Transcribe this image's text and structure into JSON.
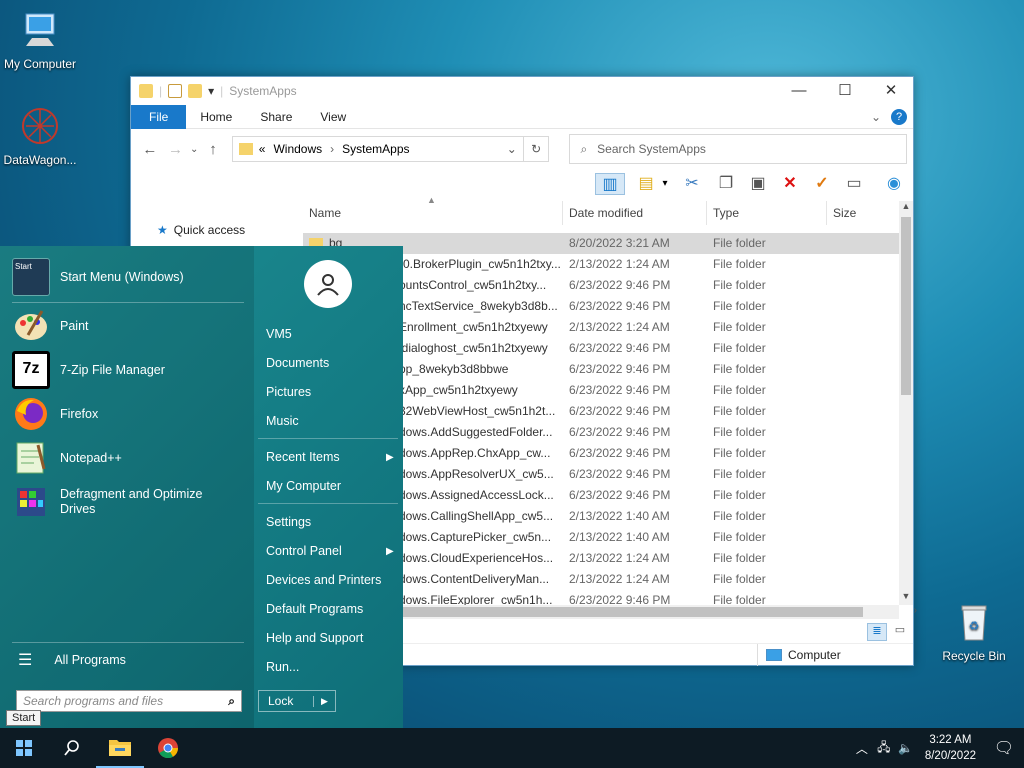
{
  "desktop": {
    "icons": [
      {
        "label": "My Computer",
        "icon": "monitor-icon"
      },
      {
        "label": "DataWagon...",
        "icon": "datawagon-icon"
      },
      {
        "label": "Recycle Bin",
        "icon": "recycle-bin-icon"
      }
    ]
  },
  "explorer": {
    "title": "SystemApps",
    "ribbon_tabs": [
      "File",
      "Home",
      "Share",
      "View"
    ],
    "address": {
      "prefix": "«",
      "crumbs": [
        "Windows",
        "SystemApps"
      ]
    },
    "search_placeholder": "Search SystemApps",
    "nav_quick_access": "Quick access",
    "columns": [
      "Name",
      "Date modified",
      "Type",
      "Size"
    ],
    "rows": [
      {
        "name": "bg",
        "date": "8/20/2022 3:21 AM",
        "type": "File folder",
        "selected": true
      },
      {
        "name": ")0.BrokerPlugin_cw5n1h2txy...",
        "date": "2/13/2022 1:24 AM",
        "type": "File folder"
      },
      {
        "name": "ountsControl_cw5n1h2txy...",
        "date": "6/23/2022 9:46 PM",
        "type": "File folder"
      },
      {
        "name": "ncTextService_8wekyb3d8b...",
        "date": "6/23/2022 9:46 PM",
        "type": "File folder"
      },
      {
        "name": "Enrollment_cw5n1h2txyewy",
        "date": "2/13/2022 1:24 AM",
        "type": "File folder"
      },
      {
        "name": "ldialoghost_cw5n1h2txyewy",
        "date": "6/23/2022 9:46 PM",
        "type": "File folder"
      },
      {
        "name": "pp_8wekyb3d8bbwe",
        "date": "6/23/2022 9:46 PM",
        "type": "File folder"
      },
      {
        "name": "xApp_cw5n1h2txyewy",
        "date": "6/23/2022 9:46 PM",
        "type": "File folder"
      },
      {
        "name": "32WebViewHost_cw5n1h2t...",
        "date": "6/23/2022 9:46 PM",
        "type": "File folder"
      },
      {
        "name": "dows.AddSuggestedFolder...",
        "date": "6/23/2022 9:46 PM",
        "type": "File folder"
      },
      {
        "name": "dows.AppRep.ChxApp_cw...",
        "date": "6/23/2022 9:46 PM",
        "type": "File folder"
      },
      {
        "name": "dows.AppResolverUX_cw5...",
        "date": "6/23/2022 9:46 PM",
        "type": "File folder"
      },
      {
        "name": "dows.AssignedAccessLock...",
        "date": "6/23/2022 9:46 PM",
        "type": "File folder"
      },
      {
        "name": "dows.CallingShellApp_cw5...",
        "date": "2/13/2022 1:40 AM",
        "type": "File folder"
      },
      {
        "name": "dows.CapturePicker_cw5n...",
        "date": "2/13/2022 1:40 AM",
        "type": "File folder"
      },
      {
        "name": "dows.CloudExperienceHos...",
        "date": "2/13/2022 1:24 AM",
        "type": "File folder"
      },
      {
        "name": "dows.ContentDeliveryMan...",
        "date": "2/13/2022 1:24 AM",
        "type": "File folder"
      },
      {
        "name": "dows.FileExplorer_cw5n1h...",
        "date": "6/23/2022 9:46 PM",
        "type": "File folder"
      }
    ],
    "status_computer": "Computer"
  },
  "start_menu": {
    "programs": [
      {
        "label": "Start Menu (Windows)",
        "icon": "start-menu-icon"
      },
      {
        "label": "Paint",
        "icon": "paint-icon"
      },
      {
        "label": "7-Zip File Manager",
        "icon": "7zip-icon"
      },
      {
        "label": "Firefox",
        "icon": "firefox-icon"
      },
      {
        "label": "Notepad++",
        "icon": "notepadpp-icon"
      },
      {
        "label": "Defragment and Optimize Drives",
        "icon": "defrag-icon"
      }
    ],
    "start_icon_text": "Start",
    "all_programs": "All Programs",
    "search_placeholder": "Search programs and files",
    "right_items": [
      "VM5",
      "Documents",
      "Pictures",
      "Music",
      "Recent Items",
      "My Computer",
      "Settings",
      "Control Panel",
      "Devices and Printers",
      "Default Programs",
      "Help and Support",
      "Run..."
    ],
    "lock": "Lock",
    "start_tooltip": "Start"
  },
  "taskbar": {
    "time": "3:22 AM",
    "date": "8/20/2022"
  }
}
